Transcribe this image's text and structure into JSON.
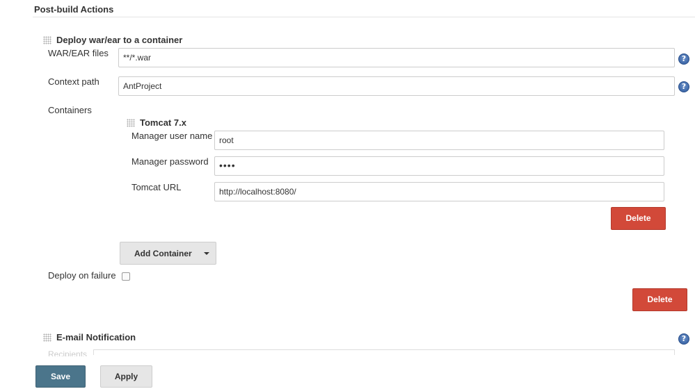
{
  "section_title": "Post-build Actions",
  "deploy": {
    "title": "Deploy war/ear to a container",
    "war_label": "WAR/EAR files",
    "war_value": "**/*.war",
    "context_label": "Context path",
    "context_value": "AntProject",
    "containers_label": "Containers",
    "tomcat": {
      "title": "Tomcat 7.x",
      "user_label": "Manager user name",
      "user_value": "root",
      "password_label": "Manager password",
      "password_value": "••••",
      "url_label": "Tomcat URL",
      "url_value": "http://localhost:8080/",
      "delete_label": "Delete"
    },
    "add_container_label": "Add Container",
    "deploy_on_failure_label": "Deploy on failure",
    "delete_label": "Delete"
  },
  "email": {
    "title": "E-mail Notification",
    "recipients_label": "Recipients"
  },
  "help_glyph": "?",
  "footer": {
    "save_label": "Save",
    "apply_label": "Apply"
  },
  "colors": {
    "delete": "#d24939",
    "save": "#4b758b",
    "help": "#2f5b9e"
  }
}
